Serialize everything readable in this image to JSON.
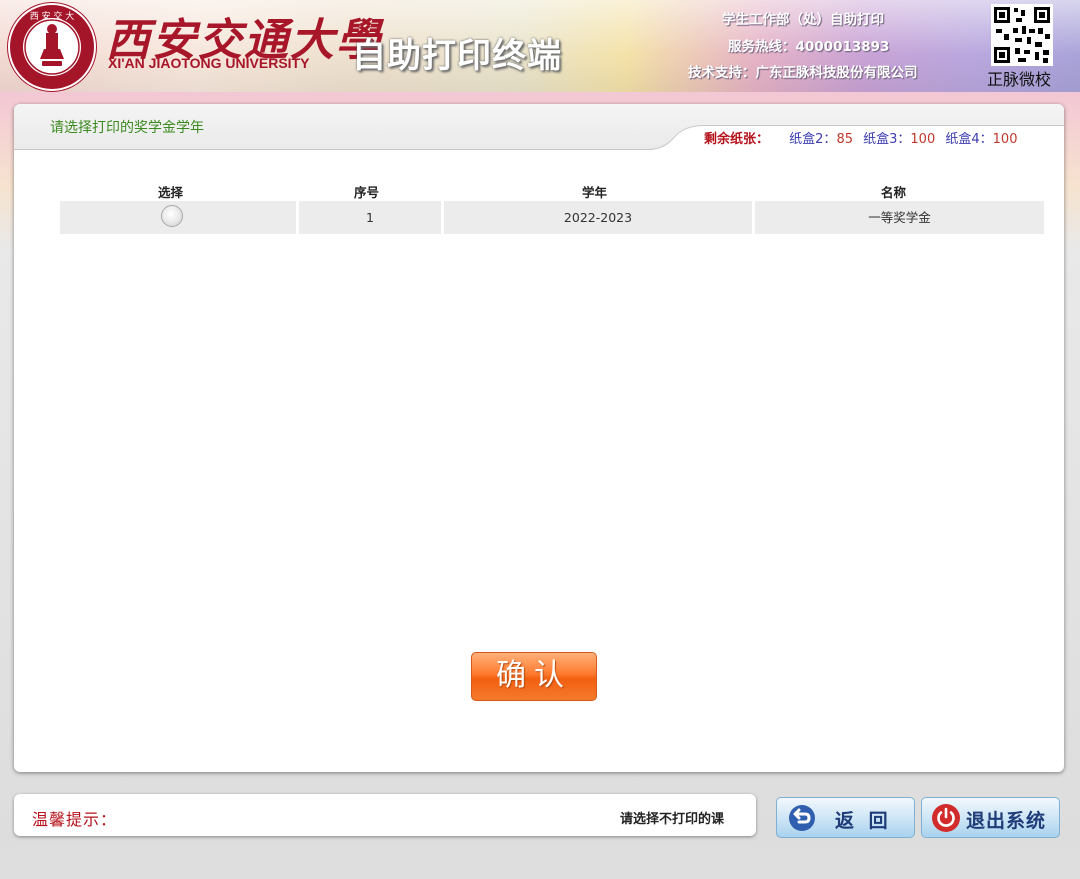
{
  "header": {
    "university_cn": "西安交通大學",
    "university_en": "XI'AN JIAOTONG UNIVERSITY",
    "terminal_title": "自助打印终端",
    "department": "学生工作部（处）自助打印",
    "hotline": "服务热线：4000013893",
    "support": "技术支持：广东正脉科技股份有限公司",
    "qr_label": "正脉微校"
  },
  "main": {
    "prompt": "请选择打印的奖学金学年",
    "paper": {
      "label": "剩余纸张：",
      "trays": [
        {
          "name": "纸盒2：",
          "count": "85"
        },
        {
          "name": "纸盒3：",
          "count": "100"
        },
        {
          "name": "纸盒4：",
          "count": "100"
        }
      ]
    },
    "table": {
      "headers": [
        "选择",
        "序号",
        "学年",
        "名称"
      ],
      "rows": [
        {
          "index": "1",
          "year": "2022-2023",
          "name": "一等奖学金",
          "selected": false
        }
      ]
    },
    "confirm_label": "确认"
  },
  "footer": {
    "tip_label": "温馨提示：",
    "tip_text": "请选择不打印的课",
    "back_label": "返 回",
    "exit_label": "退出系统"
  },
  "colors": {
    "brand_red": "#a8162a",
    "prompt_green": "#3b8a1f",
    "confirm_orange": "#f25f10",
    "nav_blue": "#a9d3ee"
  }
}
